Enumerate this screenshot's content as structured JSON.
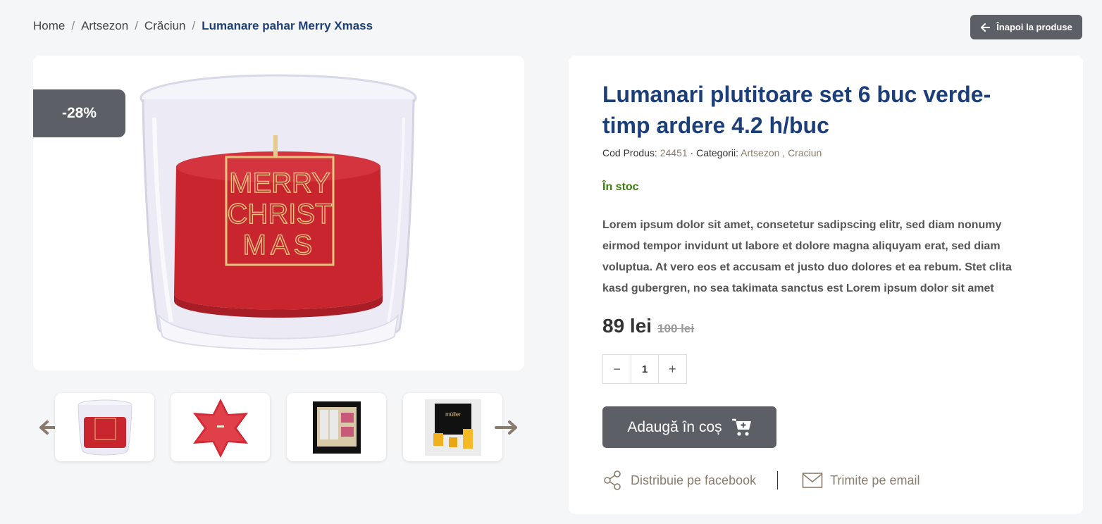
{
  "breadcrumb": {
    "items": [
      "Home",
      "Artsezon",
      "Crăciun"
    ],
    "current": "Lumanare pahar Merry Xmass",
    "separator": "/"
  },
  "back_button": {
    "label": "Înapoi la produse",
    "icon": "arrow-left-icon"
  },
  "gallery": {
    "discount_badge": "-28%",
    "candle_text": [
      "MERRY",
      "CHRIST",
      "MAS"
    ],
    "thumbnails": [
      "candle-glass",
      "star-candle",
      "gift-box",
      "candle-set"
    ],
    "arrow_color": "#8a7c6c"
  },
  "product": {
    "title": "Lumanari plutitoare set 6 buc verde-timp ardere 4.2 h/buc",
    "code_label": "Cod Produs:",
    "code": "24451",
    "meta_sep": "·",
    "categories_label": "Categorii:",
    "categories": "Artsezon , Craciun",
    "stock": "În stoc",
    "description": "Lorem ipsum dolor sit amet, consetetur sadipscing elitr, sed diam nonumy eirmod tempor invidunt ut labore et dolore magna aliquyam erat, sed diam voluptua. At vero eos et accusam et justo duo dolores et ea rebum. Stet clita kasd gubergren, no sea takimata sanctus est Lorem ipsum dolor sit amet",
    "price": "89 lei",
    "old_price": "100 lei",
    "quantity": "1",
    "minus": "−",
    "plus": "+",
    "add_to_cart": "Adaugă în coș",
    "share_facebook": "Distribuie pe facebook",
    "share_email": "Trimite pe email"
  },
  "colors": {
    "title": "#1c3f7a",
    "button": "#5d5f66",
    "stock": "#3d7a0d",
    "accent": "#8a7c6c"
  }
}
